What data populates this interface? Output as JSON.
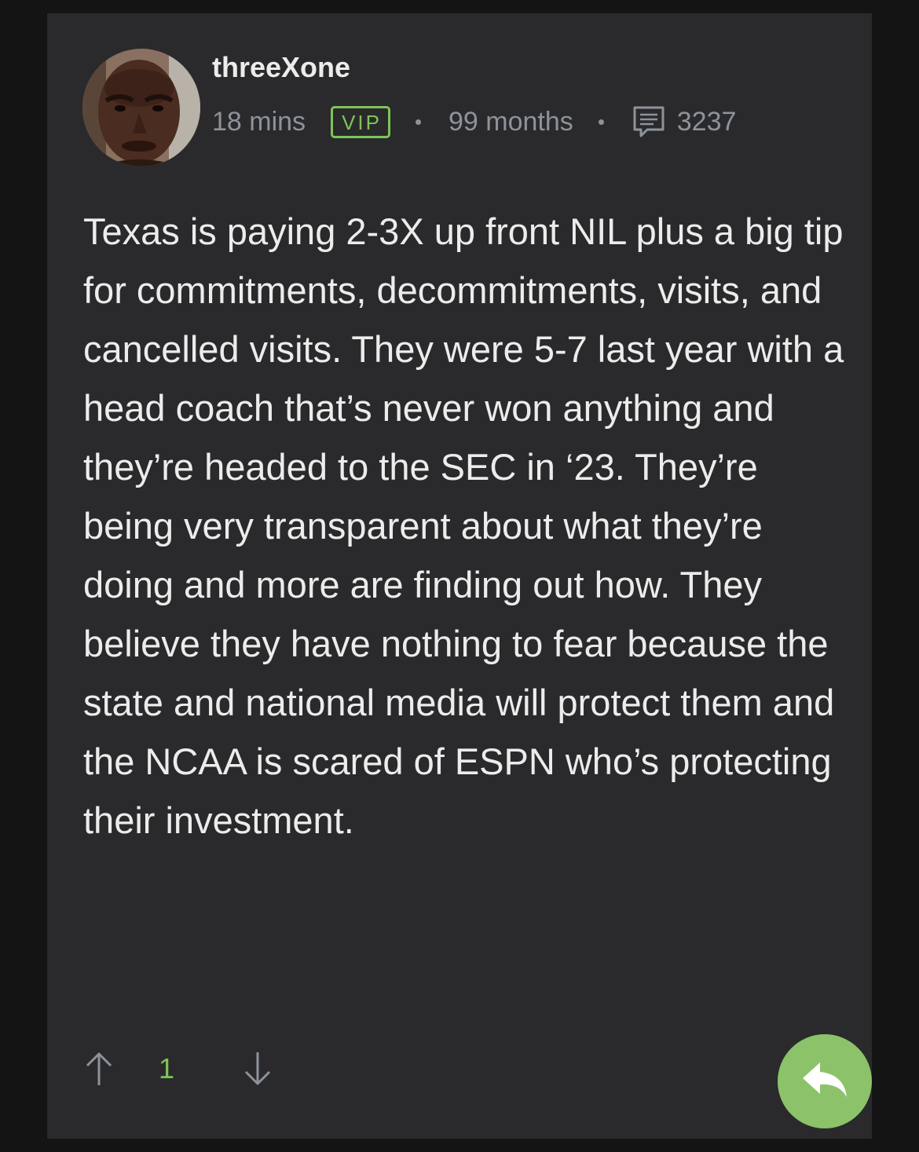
{
  "post": {
    "username": "threeXone",
    "time_ago": "18 mins",
    "badge": "VIP",
    "membership": "99 months",
    "post_count": "3237",
    "body": "Texas is paying 2-3X up front NIL plus a big tip for commitments, decommitments, visits, and cancelled visits. They were 5-7 last year with a head coach that’s never won anything and they’re headed to the SEC in ‘23. They’re being very transparent about what they’re doing and more are finding out how. They believe they have nothing to fear because the state and national media will protect them and the NCAA is scared of ESPN who’s protecting their investment."
  },
  "votes": {
    "count": "1"
  },
  "icons": {
    "comment": "comment-icon",
    "upvote": "arrow-up-icon",
    "downvote": "arrow-down-icon",
    "reply": "reply-icon"
  },
  "colors": {
    "background": "#141414",
    "card": "#2a2a2c",
    "text": "#ececec",
    "muted": "#8d929b",
    "accent_green": "#7ec456",
    "reply_button": "#8cc36a"
  }
}
